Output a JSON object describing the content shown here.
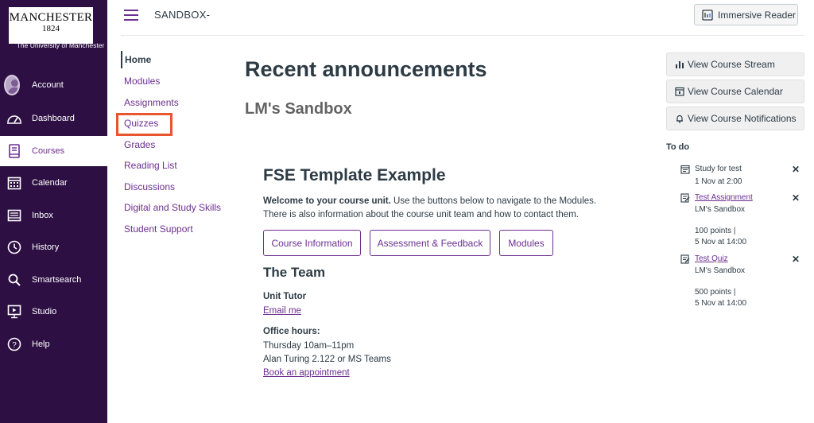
{
  "logo": {
    "line1": "MANCHESTER",
    "line2": "1824",
    "sub": "The University of Manchester"
  },
  "global_nav": [
    {
      "label": "Account",
      "icon": "account-avatar"
    },
    {
      "label": "Dashboard",
      "icon": "dashboard-icon"
    },
    {
      "label": "Courses",
      "icon": "courses-icon",
      "active": true
    },
    {
      "label": "Calendar",
      "icon": "calendar-icon"
    },
    {
      "label": "Inbox",
      "icon": "inbox-icon"
    },
    {
      "label": "History",
      "icon": "history-icon"
    },
    {
      "label": "Smartsearch",
      "icon": "search-icon"
    },
    {
      "label": "Studio",
      "icon": "studio-icon"
    },
    {
      "label": "Help",
      "icon": "help-icon"
    }
  ],
  "header": {
    "breadcrumb": "SANDBOX-",
    "immersive_reader": "Immersive Reader"
  },
  "course_nav": [
    {
      "label": "Home",
      "active": true
    },
    {
      "label": "Modules"
    },
    {
      "label": "Assignments"
    },
    {
      "label": "Quizzes",
      "highlighted": true
    },
    {
      "label": "Grades"
    },
    {
      "label": "Reading List"
    },
    {
      "label": "Discussions"
    },
    {
      "label": "Digital and Study Skills"
    },
    {
      "label": "Student Support"
    }
  ],
  "main": {
    "title": "Recent announcements",
    "subtitle": "LM's Sandbox",
    "fse_title": "FSE Template Example",
    "welcome_bold": "Welcome to your course unit.",
    "welcome_rest": " Use the buttons below to navigate to the Modules. There is also information about the course unit team and how to contact them.",
    "buttons": [
      "Course Information",
      "Assessment & Feedback",
      "Modules"
    ],
    "team_title": "The Team",
    "unit_tutor_label": "Unit Tutor",
    "email_link": "Email me",
    "office_hours_label": "Office hours:",
    "office_hours_time": "Thursday 10am–11pm",
    "office_location": "Alan Turing 2.122 or MS Teams",
    "book_link": "Book an appointment"
  },
  "right_sidebar": {
    "buttons": [
      "View Course Stream",
      "View Course Calendar",
      "View Course Notifications"
    ],
    "todo_heading": "To do",
    "todo": [
      {
        "title": "Study for test",
        "linked": false,
        "course": "",
        "date": "1 Nov at 2:00",
        "points": ""
      },
      {
        "title": "Test Assignment",
        "linked": true,
        "course": "LM's Sandbox",
        "points": "100 points  |",
        "date": "5 Nov at 14:00"
      },
      {
        "title": "Test Quiz",
        "linked": true,
        "course": "LM's Sandbox",
        "points": "500 points  |",
        "date": "5 Nov at 14:00"
      }
    ],
    "dismiss_glyph": "✕"
  },
  "colors": {
    "nav_bg": "#2d0f44",
    "accent": "#6c2f8f",
    "highlight": "#e8552e",
    "text": "#2d3b45"
  }
}
